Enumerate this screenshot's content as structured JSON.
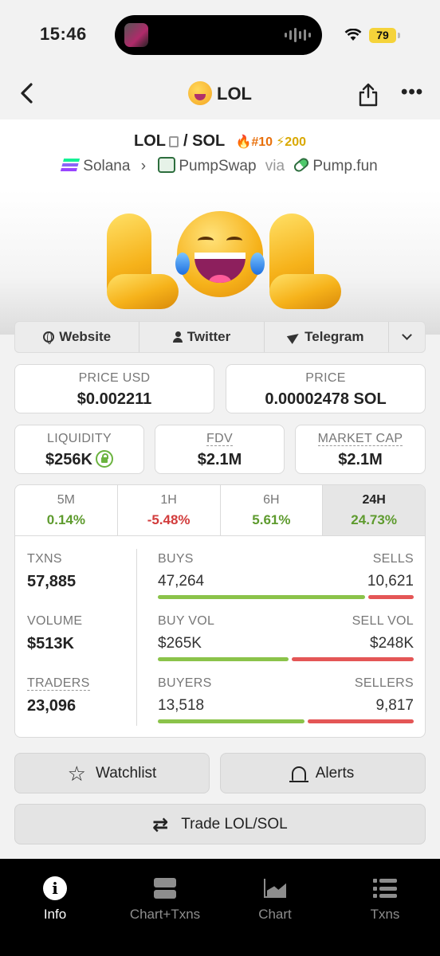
{
  "status_bar": {
    "time": "15:46",
    "battery": "79"
  },
  "nav": {
    "title": "LOL"
  },
  "pair": {
    "base": "LOL",
    "separator": "/",
    "quote": "SOL",
    "rank": "#10",
    "boost": "200",
    "chain": "Solana",
    "dex": "PumpSwap",
    "via": "via",
    "launchpad": "Pump.fun"
  },
  "banner": {
    "text": "LOL"
  },
  "links": {
    "website": "Website",
    "twitter": "Twitter",
    "telegram": "Telegram"
  },
  "prices": {
    "price_usd_label": "PRICE USD",
    "price_usd": "$0.002211",
    "price_label": "PRICE",
    "price": "0.00002478 SOL"
  },
  "metrics": {
    "liquidity_label": "LIQUIDITY",
    "liquidity": "$256K",
    "fdv_label": "FDV",
    "fdv": "$2.1M",
    "mcap_label": "MARKET CAP",
    "mcap": "$2.1M"
  },
  "periods": [
    {
      "label": "5M",
      "change": "0.14%",
      "trend": "up"
    },
    {
      "label": "1H",
      "change": "-5.48%",
      "trend": "down"
    },
    {
      "label": "6H",
      "change": "5.61%",
      "trend": "up"
    },
    {
      "label": "24H",
      "change": "24.73%",
      "trend": "up",
      "selected": true
    }
  ],
  "stats": {
    "txns": {
      "label": "TXNS",
      "value": "57,885",
      "left_label": "BUYS",
      "left": "47,264",
      "right_label": "SELLS",
      "right": "10,621",
      "buy_share": 0.817
    },
    "volume": {
      "label": "VOLUME",
      "value": "$513K",
      "left_label": "BUY VOL",
      "left": "$265K",
      "right_label": "SELL VOL",
      "right": "$248K",
      "buy_share": 0.517
    },
    "traders": {
      "label": "TRADERS",
      "value": "23,096",
      "left_label": "BUYERS",
      "left": "13,518",
      "right_label": "SELLERS",
      "right": "9,817",
      "buy_share": 0.579
    }
  },
  "actions": {
    "watchlist": "Watchlist",
    "alerts": "Alerts",
    "trade": "Trade LOL/SOL"
  },
  "tabbar": [
    {
      "label": "Info",
      "icon": "info-icon",
      "active": true
    },
    {
      "label": "Chart+Txns",
      "icon": "split-view-icon"
    },
    {
      "label": "Chart",
      "icon": "area-chart-icon"
    },
    {
      "label": "Txns",
      "icon": "list-icon"
    }
  ],
  "colors": {
    "positive": "#5e9b2e",
    "negative": "#d23c3c",
    "buy_bar": "#8bc34a",
    "sell_bar": "#e45656",
    "rank": "#e8700c"
  }
}
